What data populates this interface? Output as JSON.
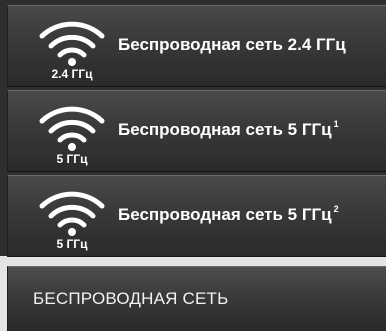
{
  "menu": {
    "items": [
      {
        "icon": "wifi-icon",
        "band": "2.4 ГГц",
        "label": "Беспроводная сеть 2.4 ГГц",
        "sup": ""
      },
      {
        "icon": "wifi-icon",
        "band": "5 ГГц",
        "label": "Беспроводная сеть 5 ГГц",
        "sup": "1"
      },
      {
        "icon": "wifi-icon",
        "band": "5 ГГц",
        "label": "Беспроводная сеть 5 ГГц",
        "sup": "2"
      }
    ]
  },
  "header": {
    "title": "БЕСПРОВОДНАЯ СЕТЬ"
  },
  "colors": {
    "text": "#ffffff",
    "panel_dark": "#2f2f2f",
    "item_top": "#4a4a4a",
    "item_bottom": "#2a2a2a",
    "page_bg": "#e4e4e4"
  }
}
